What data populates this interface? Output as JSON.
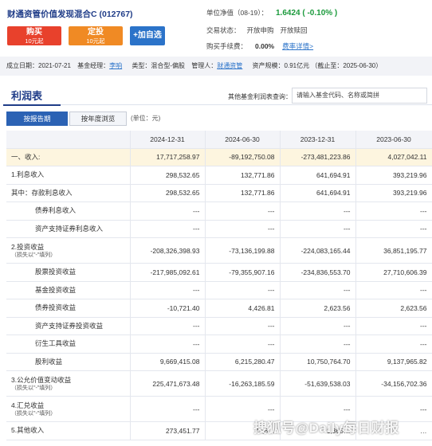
{
  "header": {
    "fund_title": "财通资管价值发现混合C (012767)",
    "buy_button": {
      "label": "购买",
      "sub": "10元起"
    },
    "dt_button": {
      "label": "定投",
      "sub": "10元起"
    },
    "add_button": {
      "label": "+加自选"
    },
    "nav_label": "单位净值（08-19）：",
    "nav_value": "1.6424 ( -0.10% )",
    "status_label": "交易状态：",
    "status_buy": "开放申购",
    "status_redeem": "开放赎回",
    "fee_label": "购买手续费：",
    "fee_value": "0.00%",
    "fee_link": "费率详情>"
  },
  "meta": {
    "established": "成立日期：2021-07-21",
    "manager_label": "基金经理：",
    "manager": "李响",
    "type": "类型：混合型-偏股",
    "company_label": "管理人：",
    "company": "财通资管",
    "scale": "资产规模：0.91亿元 （截止至：2025-06-30）"
  },
  "panel": {
    "title": "利润表",
    "query_label": "其他基金利润表查询：",
    "query_placeholder": "请输入基金代码、名称或简拼",
    "tabs": [
      "按报告期",
      "按年度浏览"
    ],
    "unit": "(单位：元)"
  },
  "table": {
    "columns": [
      "",
      "2024-12-31",
      "2024-06-30",
      "2023-12-31",
      "2023-06-30"
    ],
    "rows": [
      {
        "label": "一、收入:",
        "sub": "",
        "values": [
          "17,717,258.97",
          "-89,192,750.08",
          "-273,481,223.86",
          "4,027,042.11"
        ]
      },
      {
        "label": "1.利息收入",
        "sub": "",
        "values": [
          "298,532.65",
          "132,771.86",
          "641,694.91",
          "393,219.96"
        ]
      },
      {
        "label": "其中：存款利息收入",
        "sub": "",
        "values": [
          "298,532.65",
          "132,771.86",
          "641,694.91",
          "393,219.96"
        ]
      },
      {
        "label": "债券利息收入",
        "sub": "",
        "values": [
          "---",
          "---",
          "---",
          "---"
        ]
      },
      {
        "label": "资产支持证券利息收入",
        "sub": "",
        "values": [
          "---",
          "---",
          "---",
          "---"
        ]
      },
      {
        "label": "2.投资收益",
        "sub": "（损失以\"-\"填列）",
        "values": [
          "-208,326,398.93",
          "-73,136,199.88",
          "-224,083,165.44",
          "36,851,195.77"
        ]
      },
      {
        "label": "股票投资收益",
        "sub": "",
        "values": [
          "-217,985,092.61",
          "-79,355,907.16",
          "-234,836,553.70",
          "27,710,606.39"
        ]
      },
      {
        "label": "基金投资收益",
        "sub": "",
        "values": [
          "---",
          "---",
          "---",
          "---"
        ]
      },
      {
        "label": "债券投资收益",
        "sub": "",
        "values": [
          "-10,721.40",
          "4,426.81",
          "2,623.56",
          "2,623.56"
        ]
      },
      {
        "label": "资产支持证券投资收益",
        "sub": "",
        "values": [
          "---",
          "---",
          "---",
          "---"
        ]
      },
      {
        "label": "衍生工具收益",
        "sub": "",
        "values": [
          "---",
          "---",
          "---",
          "---"
        ]
      },
      {
        "label": "股利收益",
        "sub": "",
        "values": [
          "9,669,415.08",
          "6,215,280.47",
          "10,750,764.70",
          "9,137,965.82"
        ]
      },
      {
        "label": "3.公允价值变动收益",
        "sub": "（损失以\"-\"填列）",
        "values": [
          "225,471,673.48",
          "-16,263,185.59",
          "-51,639,538.03",
          "-34,156,702.36"
        ]
      },
      {
        "label": "4.汇兑收益",
        "sub": "（损失以\"-\"填列）",
        "values": [
          "---",
          "---",
          "---",
          "---"
        ]
      },
      {
        "label": "5.其他收入",
        "sub": "",
        "values": [
          "273,451.77",
          "73,6…",
          "-1,365…",
          "…"
        ]
      }
    ]
  },
  "watermark": "搜狐号@Daily每日财报"
}
